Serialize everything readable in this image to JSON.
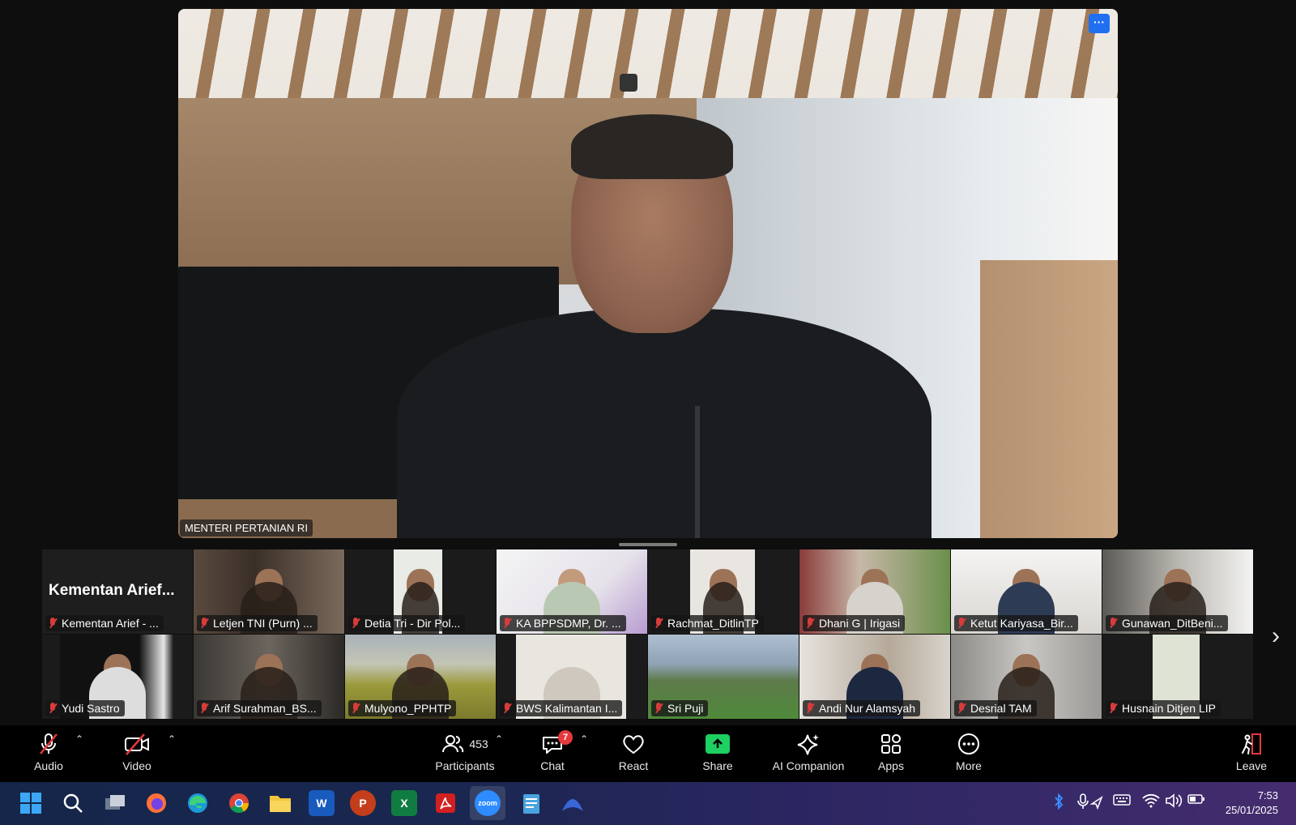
{
  "speaker": {
    "name": "MENTERI PERTANIAN RI",
    "more_label": "···"
  },
  "gallery": {
    "top_row": [
      {
        "label": "Kementan Arief - ...",
        "big_name": "Kementan  Arief..."
      },
      {
        "label": "Letjen TNI (Purn) ..."
      },
      {
        "label": "Detia Tri - Dir Pol..."
      },
      {
        "label": "KA BPPSDMP, Dr. ..."
      },
      {
        "label": "Rachmat_DitlinTP"
      },
      {
        "label": "Dhani G | Irigasi"
      },
      {
        "label": "Ketut Kariyasa_Bir..."
      },
      {
        "label": "Gunawan_DitBeni..."
      }
    ],
    "bottom_row": [
      {
        "label": "Yudi Sastro"
      },
      {
        "label": "Arif Surahman_BS..."
      },
      {
        "label": "Mulyono_PPHTP"
      },
      {
        "label": "BWS Kalimantan I..."
      },
      {
        "label": "Sri Puji"
      },
      {
        "label": "Andi Nur Alamsyah"
      },
      {
        "label": "Desrial TAM"
      },
      {
        "label": "Husnain Ditjen LIP"
      }
    ],
    "next_label": "›"
  },
  "toolbar": {
    "audio": "Audio",
    "video": "Video",
    "participants": "Participants",
    "participants_count": "453",
    "chat": "Chat",
    "chat_badge": "7",
    "react": "React",
    "share": "Share",
    "ai_companion": "AI Companion",
    "apps": "Apps",
    "more": "More",
    "leave": "Leave",
    "caret": "⌃"
  },
  "taskbar": {
    "zoom_label": "zoom",
    "word_label": "W",
    "ppt_label": "P",
    "excel_label": "X",
    "time": "7:53",
    "date": "25/01/2025"
  },
  "colors": {
    "share_green": "#1ecf61",
    "mute_red": "#d93b3b",
    "accent_blue": "#1f6ff0",
    "badge_red": "#e5393d"
  }
}
